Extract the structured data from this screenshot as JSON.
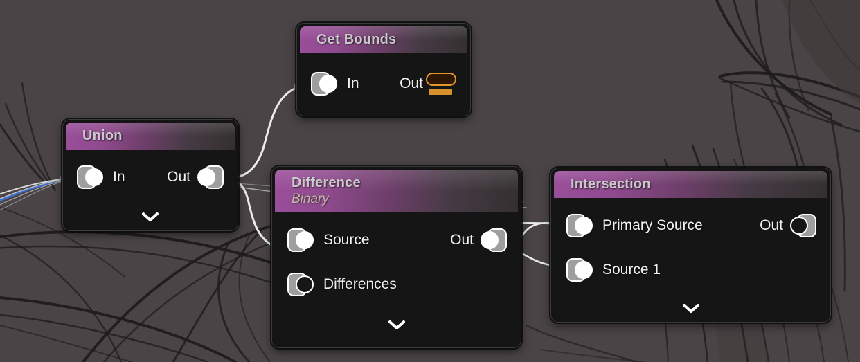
{
  "canvas": {
    "name": "node-graph-canvas",
    "background_color": "#4a4446",
    "sketch_stroke_color": "#1c1a1a"
  },
  "theme": {
    "node_body_color": "#151515",
    "header_accent_color": "#9a4e9a",
    "header_fade_color": "#33302f",
    "port_color": "#9e9e9e",
    "port_outline_color": "#ffffff",
    "label_color": "#f2f2f2",
    "title_color": "#c9c9c9",
    "subtitle_color": "#c2b8a0",
    "wire_color": "#e8e8e8",
    "wire_accent_color": "#3f6fd1",
    "data_pill_color": "#d9912c"
  },
  "nodes": [
    {
      "id": "get-bounds",
      "title": "Get Bounds",
      "subtitle": "",
      "inputs": [
        {
          "label": "In",
          "port_style": "filled"
        }
      ],
      "outputs": [
        {
          "label": "Out",
          "port_style": "data-pill"
        }
      ],
      "has_expander": false,
      "expander_icon": "chevron-down-icon"
    },
    {
      "id": "union",
      "title": "Union",
      "subtitle": "",
      "inputs": [
        {
          "label": "In",
          "port_style": "filled"
        }
      ],
      "outputs": [
        {
          "label": "Out",
          "port_style": "filled"
        }
      ],
      "has_expander": true,
      "expander_icon": "chevron-down-icon"
    },
    {
      "id": "difference",
      "title": "Difference",
      "subtitle": "Binary",
      "inputs": [
        {
          "label": "Source",
          "port_style": "filled"
        },
        {
          "label": "Differences",
          "port_style": "hollow"
        }
      ],
      "outputs": [
        {
          "label": "Out",
          "port_style": "filled"
        }
      ],
      "has_expander": true,
      "expander_icon": "chevron-down-icon"
    },
    {
      "id": "intersection",
      "title": "Intersection",
      "subtitle": "",
      "inputs": [
        {
          "label": "Primary Source",
          "port_style": "filled"
        },
        {
          "label": "Source 1",
          "port_style": "filled"
        }
      ],
      "outputs": [
        {
          "label": "Out",
          "port_style": "hollow"
        }
      ],
      "has_expander": true,
      "expander_icon": "chevron-down-icon"
    }
  ],
  "connections": [
    {
      "from": "external",
      "to": "union.In",
      "color": "#3f6fd1"
    },
    {
      "from": "union.Out",
      "to": "get-bounds.In",
      "color": "#e8e8e8"
    },
    {
      "from": "union.Out",
      "to": "difference.Source",
      "color": "#e8e8e8"
    },
    {
      "from": "difference.Out",
      "to": "intersection.Primary Source",
      "color": "#e8e8e8"
    },
    {
      "from": "difference.Out",
      "to": "intersection.Source 1",
      "color": "#e8e8e8"
    }
  ]
}
